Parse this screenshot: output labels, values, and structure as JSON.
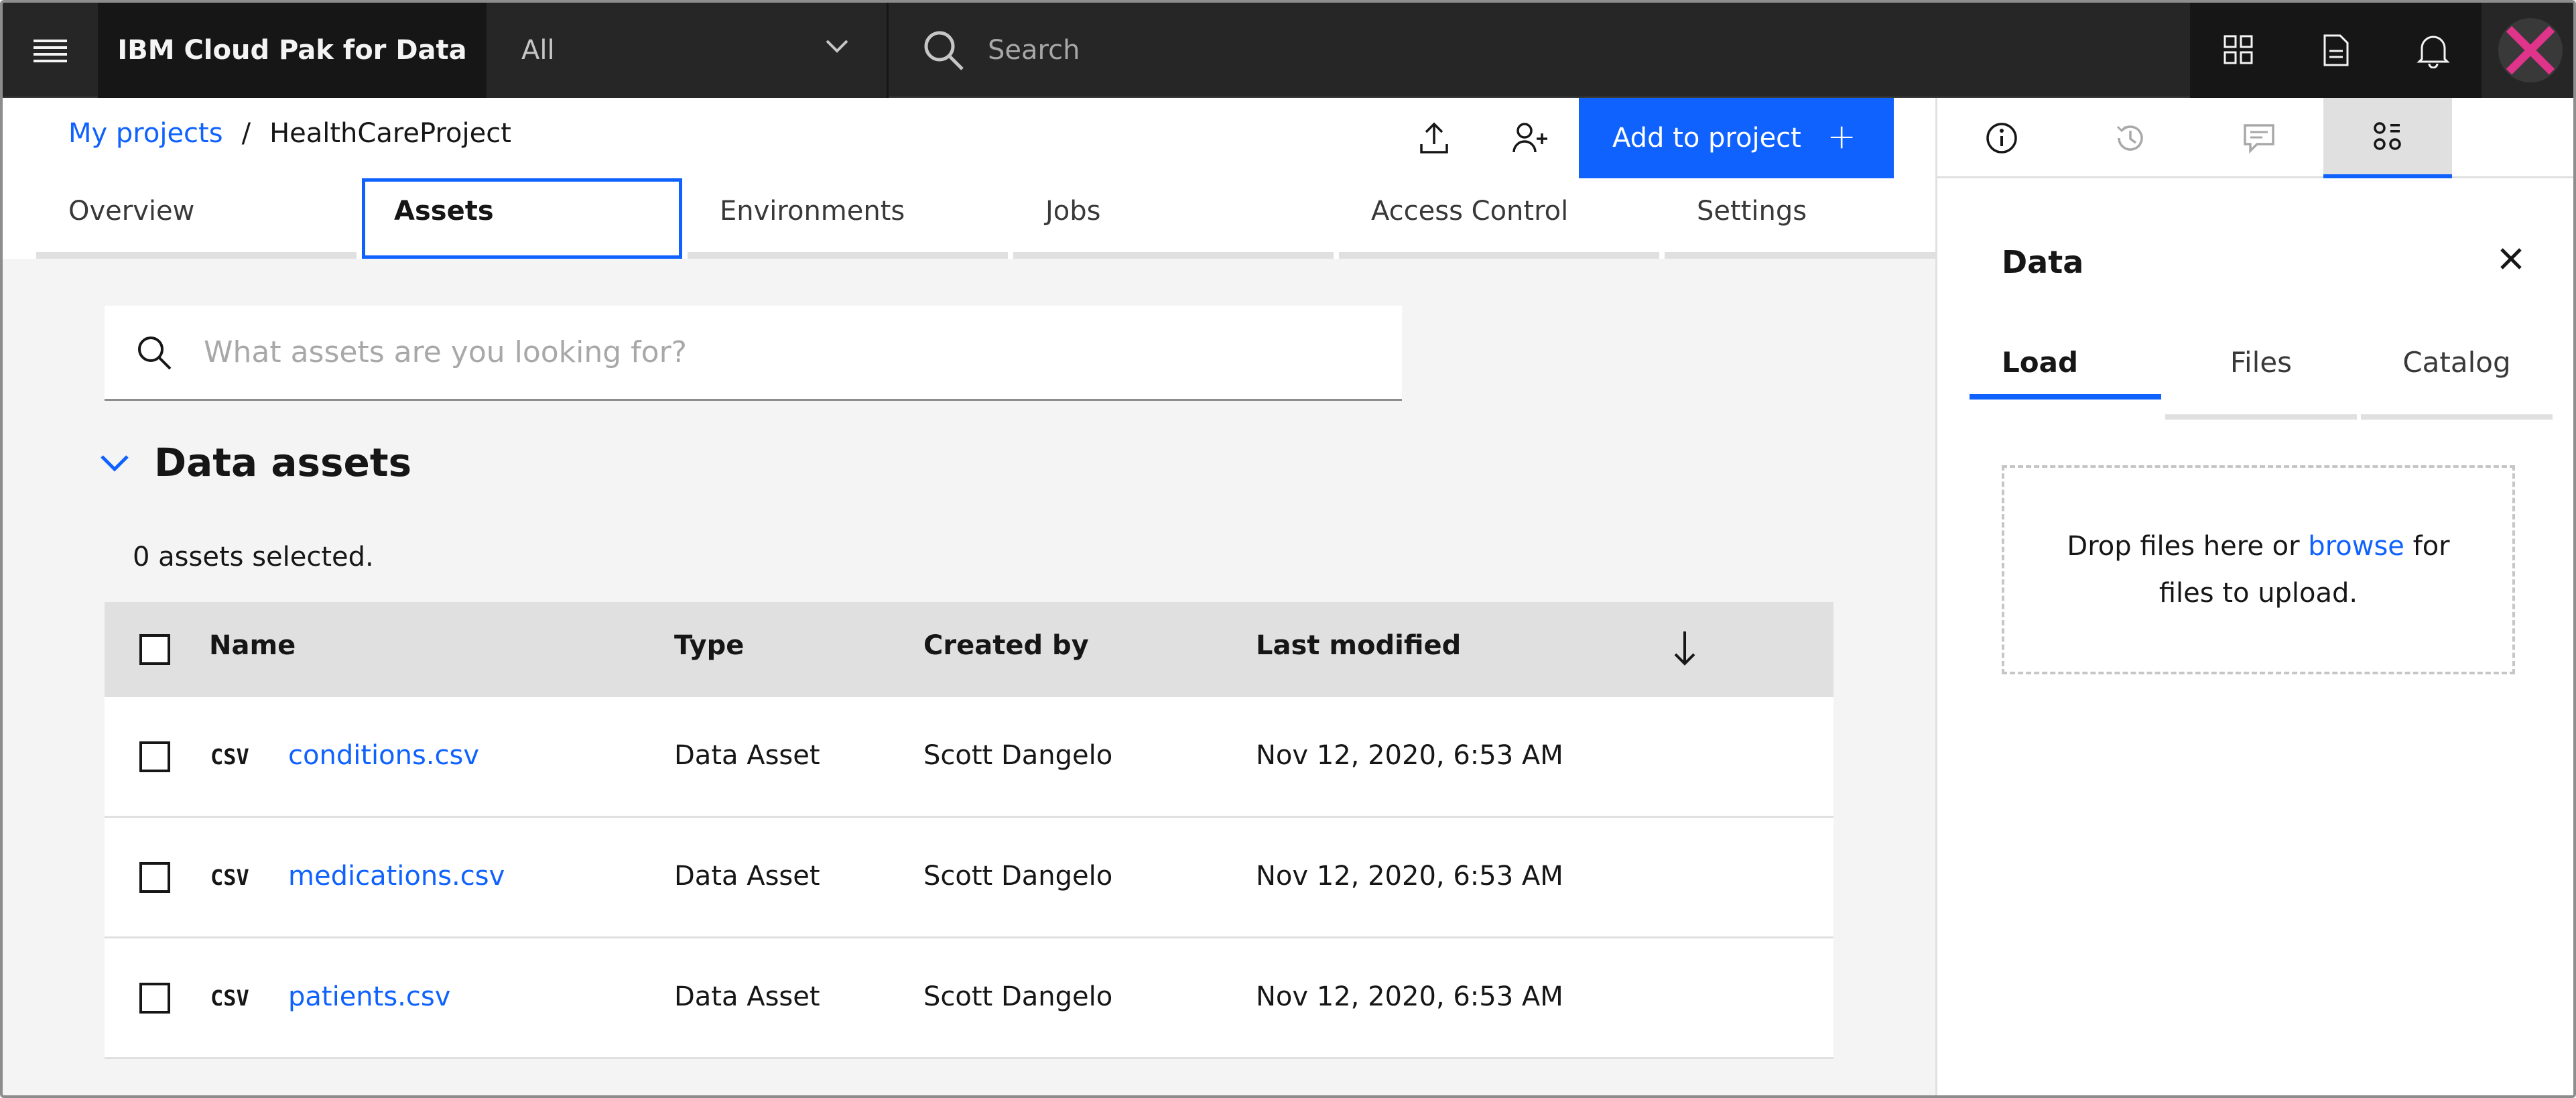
{
  "header": {
    "brand": "IBM Cloud Pak for Data",
    "scope_value": "All",
    "search_placeholder": "Search",
    "icons": [
      "hamburger-icon",
      "apps-grid-icon",
      "document-icon",
      "notification-bell-icon",
      "avatar"
    ]
  },
  "project": {
    "breadcrumb_root": "My projects",
    "breadcrumb_separator": "/",
    "project_name": "HealthCareProject",
    "add_button_label": "Add to project",
    "add_button_icon": "+"
  },
  "tabs": [
    "Overview",
    "Assets",
    "Environments",
    "Jobs",
    "Access Control",
    "Settings"
  ],
  "active_tab": "Assets",
  "main": {
    "search_placeholder": "What assets are you looking for?",
    "section_title": "Data assets",
    "selected_count": "0 assets selected.",
    "columns": [
      "Name",
      "Type",
      "Created by",
      "Last modified"
    ],
    "rows": [
      {
        "filetype": "CSV",
        "name": "conditions.csv",
        "type": "Data Asset",
        "created_by": "Scott Dangelo",
        "last_modified": "Nov 12, 2020, 6:53 AM"
      },
      {
        "filetype": "CSV",
        "name": "medications.csv",
        "type": "Data Asset",
        "created_by": "Scott Dangelo",
        "last_modified": "Nov 12, 2020, 6:53 AM"
      },
      {
        "filetype": "CSV",
        "name": "patients.csv",
        "type": "Data Asset",
        "created_by": "Scott Dangelo",
        "last_modified": "Nov 12, 2020, 6:53 AM"
      }
    ]
  },
  "panel": {
    "title": "Data",
    "subtabs": [
      "Load",
      "Files",
      "Catalog"
    ],
    "active_subtab": "Load",
    "drop_text_before": "Drop files here or",
    "drop_link": "browse",
    "drop_text_after_line1": "for",
    "drop_text_line2": "files to upload."
  },
  "colors": {
    "accent": "#0f62fe",
    "header_bg": "#262626",
    "brand_bg": "#161616",
    "page_bg": "#f4f4f4",
    "avatar_mark": "#e0338a"
  }
}
